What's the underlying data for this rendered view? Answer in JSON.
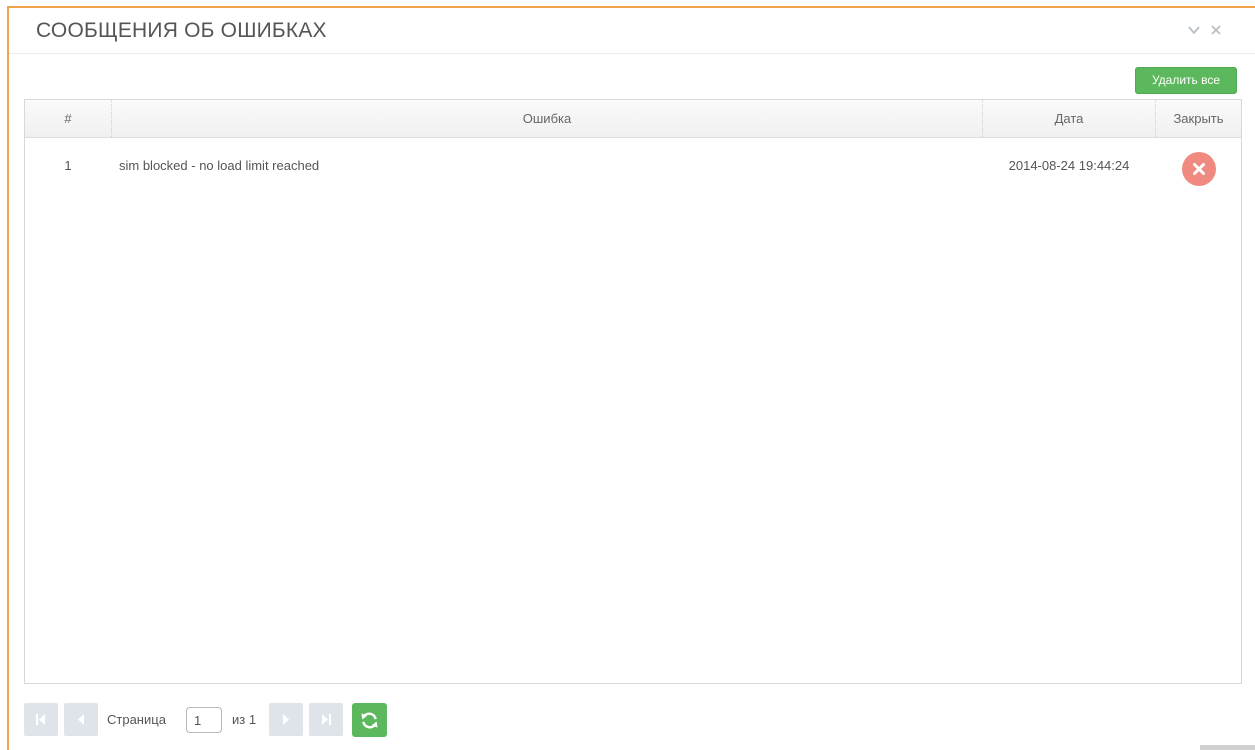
{
  "window": {
    "title": "СООБЩЕНИЯ ОБ ОШИБКАХ",
    "controls": [
      "chevron-down-icon",
      "close-icon"
    ],
    "border_color": "#f0a24a"
  },
  "toolbar": {
    "delete_all_label": "Удалить все",
    "delete_all_color": "#5cb85c"
  },
  "table": {
    "columns": {
      "num": "#",
      "error": "Ошибка",
      "date": "Дата",
      "close": "Закрыть"
    },
    "rows": [
      {
        "num": "1",
        "error": "sim blocked - no load limit reached",
        "date": "2014-08-24 19:44:24",
        "close_icon": "close-circle-icon",
        "close_color": "#f08a80"
      }
    ]
  },
  "pager": {
    "page_label": "Страница",
    "page_value": "1",
    "of_label": "из 1",
    "buttons": [
      "first-page-icon",
      "prev-page-icon",
      "next-page-icon",
      "last-page-icon",
      "refresh-icon"
    ]
  }
}
